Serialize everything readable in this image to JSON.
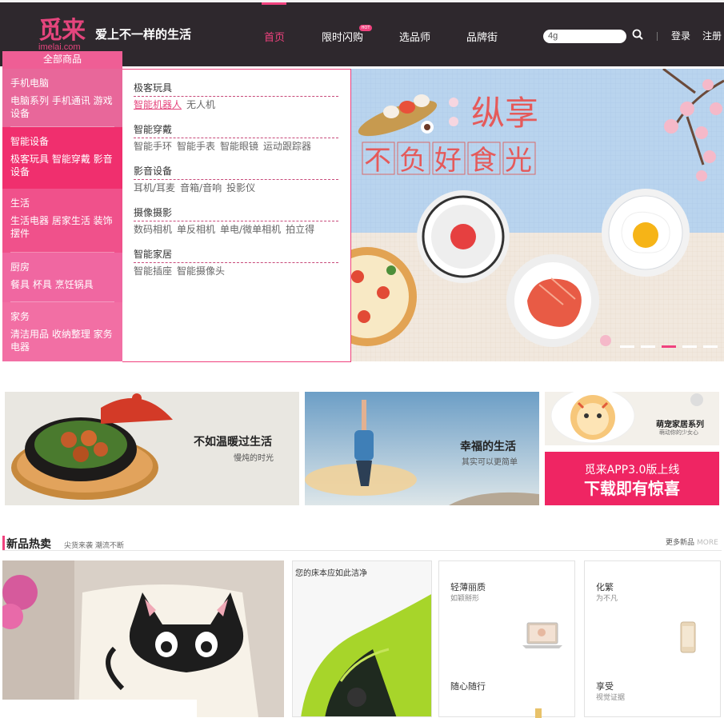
{
  "brand": {
    "logo_cn": "觅来",
    "logo_en": "imelai.com",
    "slogan": "爱上不一样的生活"
  },
  "nav": {
    "home": "首页",
    "flash": "限时闪购",
    "flash_badge": "HOT",
    "select": "选品师",
    "brand_street": "品牌街"
  },
  "search": {
    "value": "4g"
  },
  "user": {
    "login": "登录",
    "register": "注册"
  },
  "menu": {
    "title": "全部商品",
    "categories": [
      {
        "title": "手机电脑",
        "items": "电脑系列 手机通讯 游戏设备"
      },
      {
        "title": "智能设备",
        "items": "极客玩具 智能穿戴 影音设备"
      },
      {
        "title": "生活",
        "items": "生活电器 居家生活 装饰摆件"
      },
      {
        "title": "厨房",
        "items": "餐具 杯具 烹饪锅具"
      },
      {
        "title": "家务",
        "items": "清洁用品 收纳整理 家务电器"
      }
    ],
    "submenu": [
      {
        "title": "极客玩具",
        "items": [
          "智能机器人",
          "无人机"
        ]
      },
      {
        "title": "智能穿戴",
        "items": [
          "智能手环",
          "智能手表",
          "智能眼镜",
          "运动跟踪器"
        ]
      },
      {
        "title": "影音设备",
        "items": [
          "耳机/耳麦",
          "音箱/音响",
          "投影仪"
        ]
      },
      {
        "title": "摄像摄影",
        "items": [
          "数码相机",
          "单反相机",
          "单电/微单相机",
          "拍立得"
        ]
      },
      {
        "title": "智能家居",
        "items": [
          "智能插座",
          "智能摄像头"
        ]
      }
    ]
  },
  "banner": {
    "line1": "纵享",
    "line2": "不负好食光",
    "slides": 5,
    "active_slide": 3
  },
  "promos": [
    {
      "title": "不如温暖过生活",
      "sub": "慢炖的时光"
    },
    {
      "title": "幸福的生活",
      "sub": "其实可以更简单"
    },
    {
      "title": "萌宠家居系列",
      "sub": "萌动你的少女心"
    },
    {
      "title": "觅来APP3.0版上线",
      "sub": "下载即有惊喜"
    }
  ],
  "new_section": {
    "title": "新品热卖",
    "sub": "尖货来袭 潮流不断",
    "more": "更多新品",
    "more_en": "MORE"
  },
  "goods": {
    "vacuum_caption": "您的床本应如此洁净",
    "laptop_title": "轻薄丽质",
    "laptop_sub": "如颖掰形",
    "phone_title": "化繁",
    "phone_sub": "为不凡",
    "follow_title": "随心随行",
    "enjoy_title": "享受",
    "enjoy_sub": "视觉证据"
  },
  "colors": {
    "accent": "#f0427e",
    "header": "#2e282d"
  }
}
